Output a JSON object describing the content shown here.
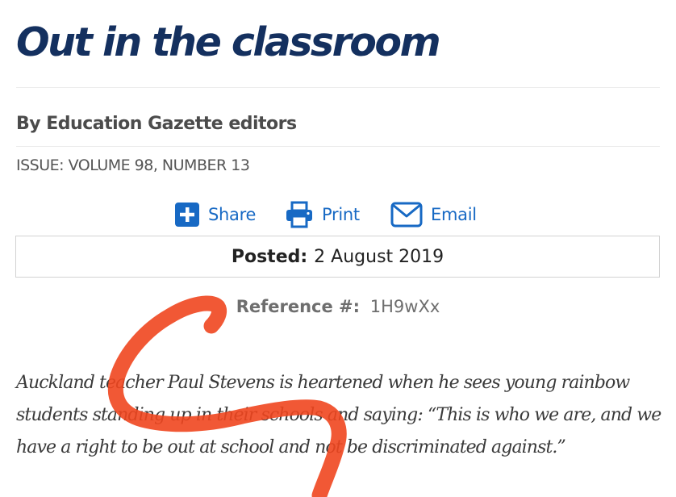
{
  "article": {
    "title": "Out in the classroom",
    "byline": "By Education Gazette editors",
    "issue": "ISSUE: VOLUME 98, NUMBER 13",
    "posted_label": "Posted:",
    "posted_value": "2 August 2019",
    "reference_label": "Reference #:",
    "reference_value": "1H9wXx",
    "lead": "Auckland teacher Paul Stevens is heartened when he sees young rainbow students standing up in their schools and saying: “This is who we are, and we have a right to be out at school and not be discriminated against.”"
  },
  "actions": {
    "share": {
      "label": "Share",
      "icon": "plus-square-icon"
    },
    "print": {
      "label": "Print",
      "icon": "printer-icon"
    },
    "email": {
      "label": "Email",
      "icon": "envelope-icon"
    }
  },
  "colors": {
    "title": "#14305f",
    "link": "#1769c4",
    "annotation": "#f0461f"
  },
  "annotation": {
    "type": "hand-drawn loop",
    "color": "#f0461f"
  }
}
